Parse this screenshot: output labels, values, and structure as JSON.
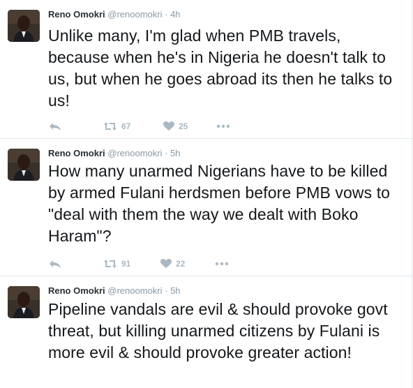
{
  "tweets": [
    {
      "author_name": "Reno Omokri",
      "handle": "@renoomokri",
      "time": "4h",
      "text": "Unlike many, I'm glad when PMB travels, because when he's in Nigeria he doesn't talk to us, but when he goes abroad its then he talks to us!",
      "retweets": "67",
      "likes": "25"
    },
    {
      "author_name": "Reno Omokri",
      "handle": "@renoomokri",
      "time": "5h",
      "text": "How many unarmed Nigerians have to be killed by armed Fulani herdsmen before PMB vows to \"deal with them the way we dealt with Boko Haram\"?",
      "retweets": "91",
      "likes": "22"
    },
    {
      "author_name": "Reno Omokri",
      "handle": "@renoomokri",
      "time": "5h",
      "text": "Pipeline vandals are evil & should provoke govt threat, but killing unarmed citizens by Fulani is more evil & should provoke greater action!"
    }
  ],
  "separator": "·",
  "icons": {
    "reply": "reply-icon",
    "retweet": "retweet-icon",
    "like": "heart-icon",
    "more": "more-icon"
  },
  "colors": {
    "text": "#14171a",
    "muted": "#8899a6",
    "action": "#aab8c2",
    "border": "#e1e8ed"
  }
}
